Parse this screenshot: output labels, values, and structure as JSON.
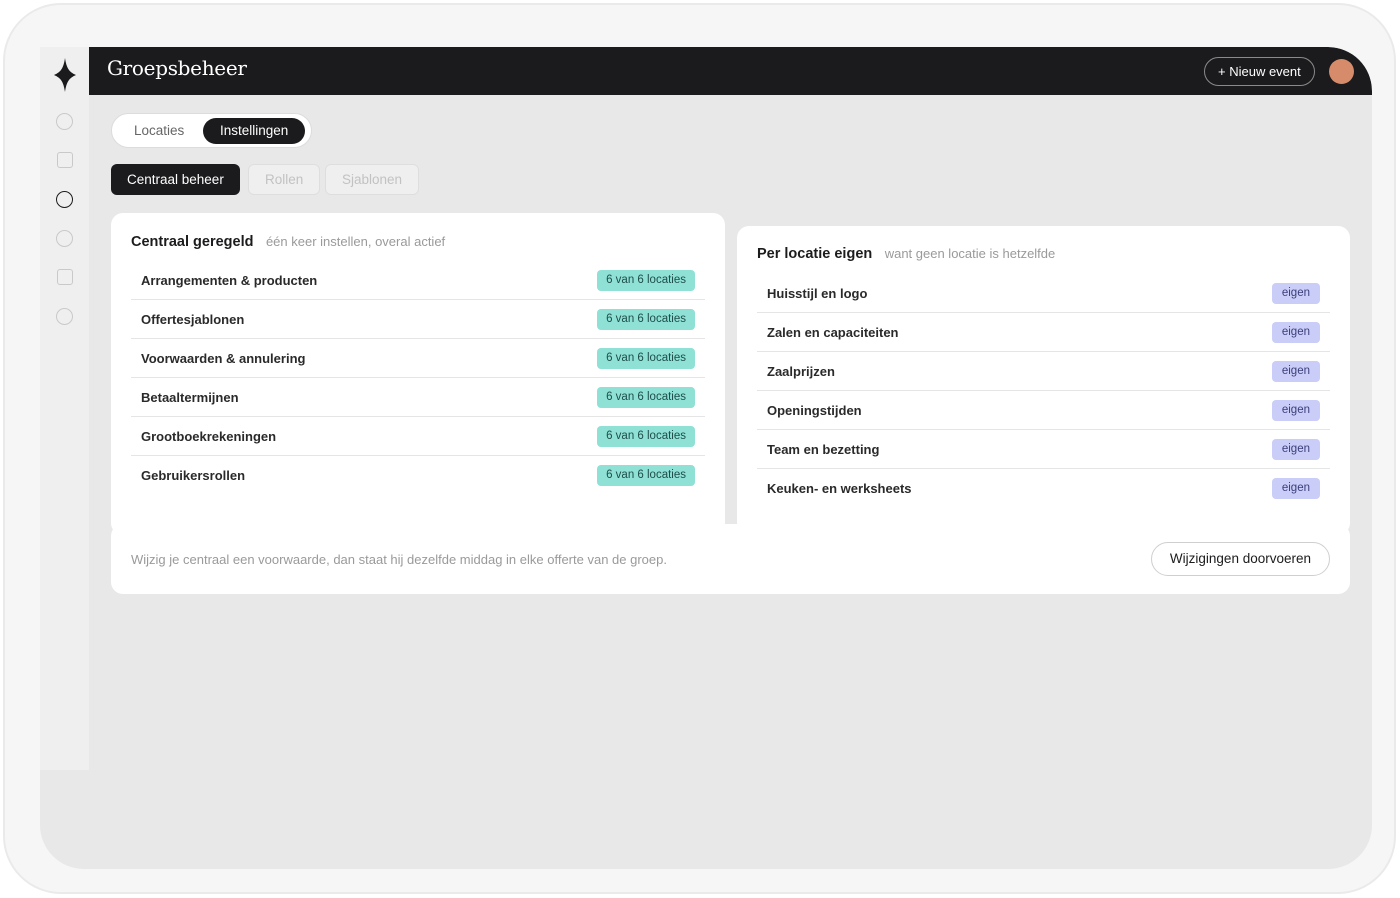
{
  "app": {
    "title": "Groepsbeheer",
    "new_event_label": "+ Nieuw event"
  },
  "sidebar": {
    "icons": [
      "circle-icon",
      "square-icon",
      "circle-icon",
      "circle-icon",
      "square-icon",
      "circle-icon"
    ]
  },
  "segment": {
    "items": [
      {
        "label": "Locaties",
        "active": false
      },
      {
        "label": "Instellingen",
        "active": true
      }
    ]
  },
  "subtabs": [
    {
      "label": "Centraal beheer",
      "active": true
    },
    {
      "label": "Rollen",
      "active": false
    },
    {
      "label": "Sjablonen",
      "active": false
    }
  ],
  "central": {
    "title": "Centraal geregeld",
    "subtitle": "één keer instellen, overal actief",
    "rows": [
      {
        "label": "Arrangementen & producten",
        "badge": "6 van 6 locaties"
      },
      {
        "label": "Offertesjablonen",
        "badge": "6 van 6 locaties"
      },
      {
        "label": "Voorwaarden & annulering",
        "badge": "6 van 6 locaties"
      },
      {
        "label": "Betaaltermijnen",
        "badge": "6 van 6 locaties"
      },
      {
        "label": "Grootboekrekeningen",
        "badge": "6 van 6 locaties"
      },
      {
        "label": "Gebruikersrollen",
        "badge": "6 van 6 locaties"
      }
    ]
  },
  "per_location": {
    "title": "Per locatie eigen",
    "subtitle": "want geen locatie is hetzelfde",
    "rows": [
      {
        "label": "Huisstijl en logo",
        "badge": "eigen"
      },
      {
        "label": "Zalen en capaciteiten",
        "badge": "eigen"
      },
      {
        "label": "Zaalprijzen",
        "badge": "eigen"
      },
      {
        "label": "Openingstijden",
        "badge": "eigen"
      },
      {
        "label": "Team en bezetting",
        "badge": "eigen"
      },
      {
        "label": "Keuken- en werksheets",
        "badge": "eigen"
      }
    ]
  },
  "footer": {
    "text": "Wijzig je centraal een voorwaarde, dan staat hij dezelfde middag in elke offerte van de groep.",
    "button_label": "Wijzigingen doorvoeren"
  },
  "colors": {
    "dark": "#1b1b1d",
    "badge_green": "#8fe1d6",
    "badge_blue": "#c9cdf7",
    "avatar": "#d68c6b"
  }
}
